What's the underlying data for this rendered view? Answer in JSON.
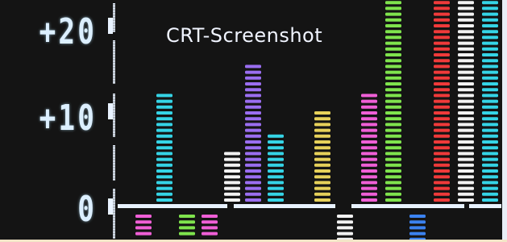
{
  "screen": {
    "watermark": "CRT-Screenshot",
    "background": "#141414"
  },
  "y_axis": {
    "tick_labels": [
      "+20",
      "+10",
      "0"
    ]
  },
  "chart_data": {
    "type": "bar",
    "ylim": [
      -5,
      26
    ],
    "bars": [
      {
        "x": 204,
        "value": 13,
        "color": "#35d4e6"
      },
      {
        "x": 288,
        "value": 6,
        "color": "#f2f2f2"
      },
      {
        "x": 314,
        "value": 16,
        "color": "#9a6ef0"
      },
      {
        "x": 342,
        "value": 8,
        "color": "#35d4e6"
      },
      {
        "x": 400,
        "value": 11,
        "color": "#e6d15a"
      },
      {
        "x": 458,
        "value": 13,
        "color": "#ef5fd6"
      },
      {
        "x": 488,
        "value": 25,
        "color": "#7fe34d"
      },
      {
        "x": 548,
        "value": 24,
        "color": "#ef3a3a"
      },
      {
        "x": 578,
        "value": 25,
        "color": "#f2f2f2"
      },
      {
        "x": 608,
        "value": 25,
        "color": "#35d4e6"
      }
    ],
    "negative_bars": [
      {
        "x": 178,
        "value": -3,
        "color": "#ef5fd6"
      },
      {
        "x": 232,
        "value": -3,
        "color": "#7fe34d"
      },
      {
        "x": 260,
        "value": -3,
        "color": "#ef5fd6"
      },
      {
        "x": 428,
        "value": -4,
        "color": "#f2f2f2"
      },
      {
        "x": 518,
        "value": -4,
        "color": "#3b82f0"
      }
    ]
  }
}
